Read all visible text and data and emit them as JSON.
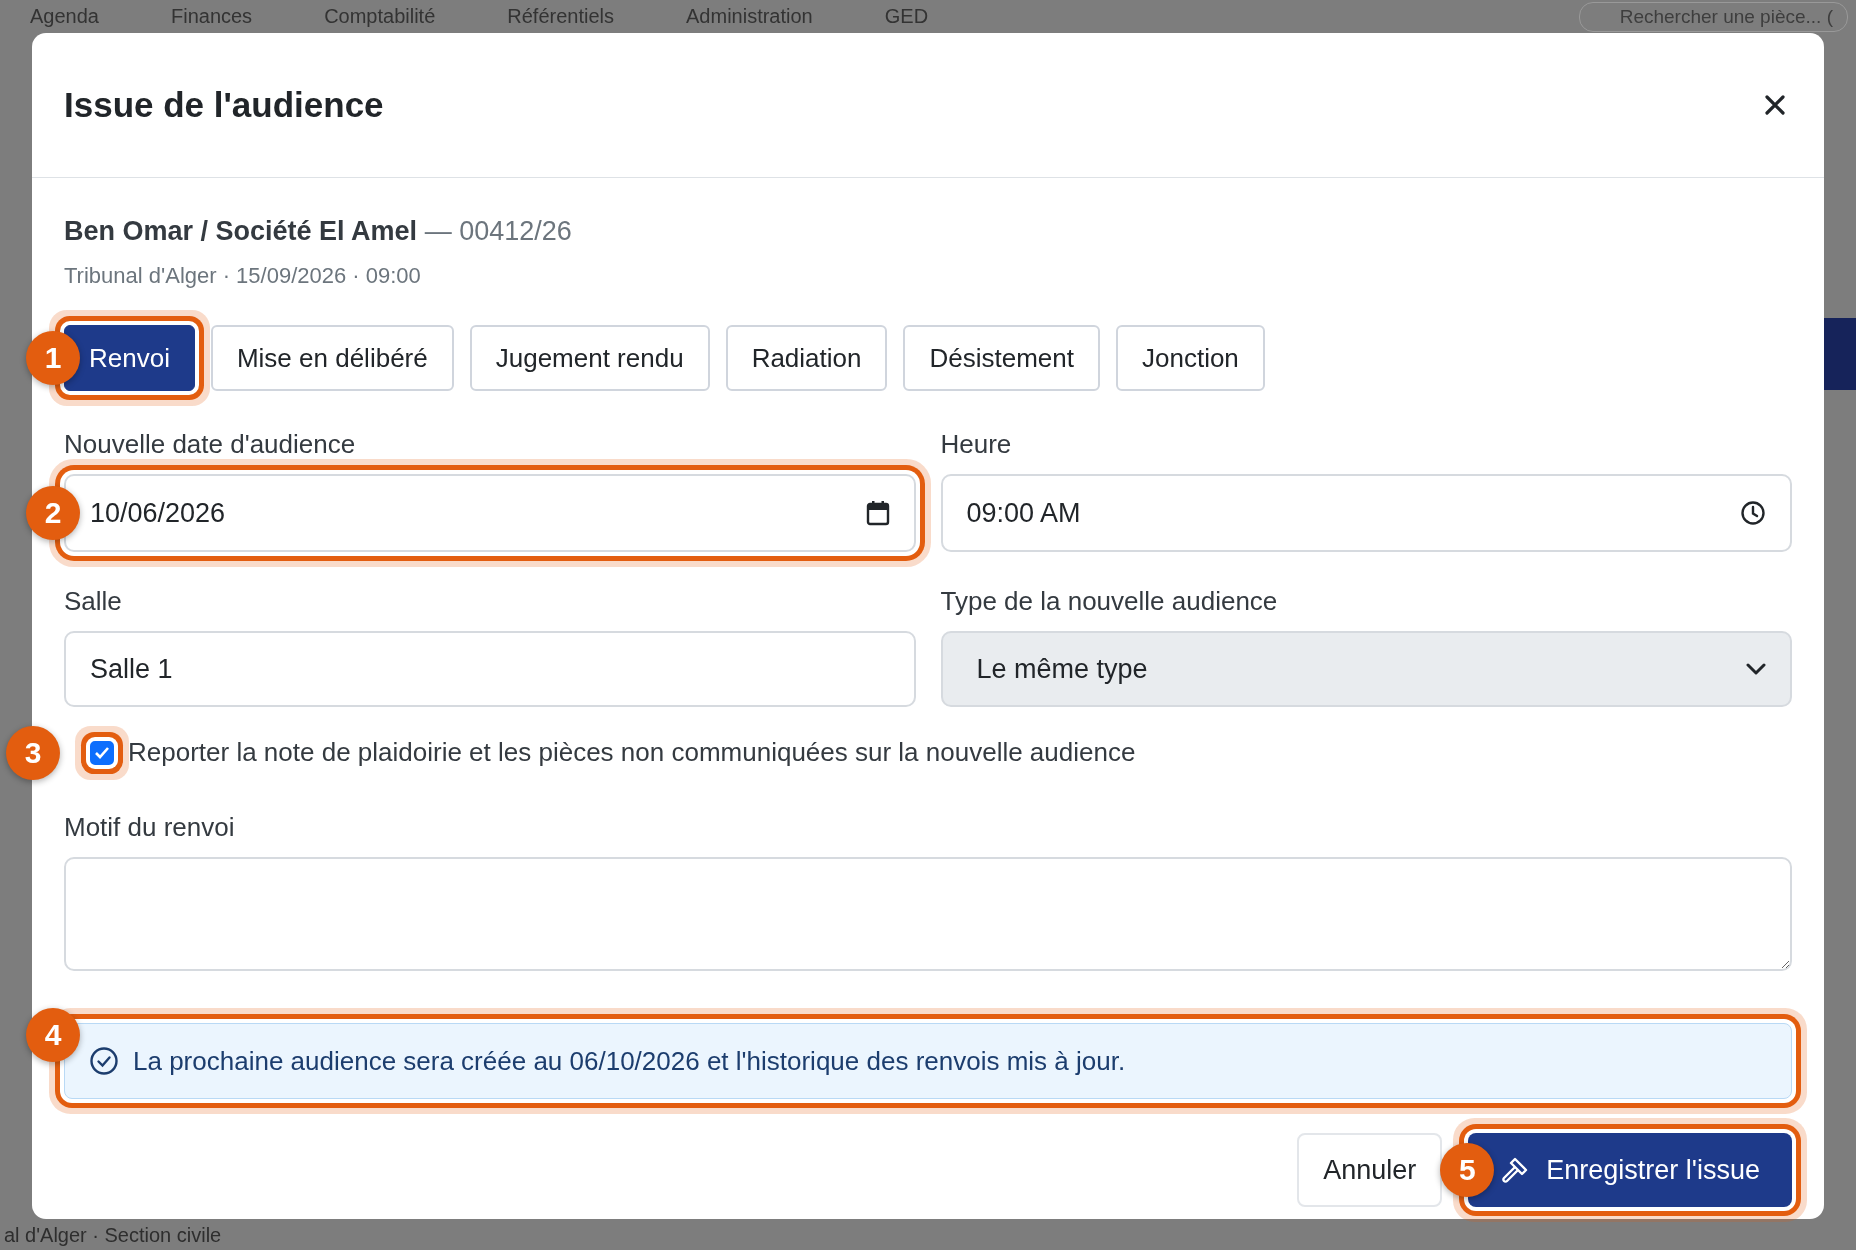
{
  "background": {
    "nav": [
      "Agenda",
      "Finances",
      "Comptabilité",
      "Référentiels",
      "Administration",
      "GED"
    ],
    "search_placeholder": "Rechercher une pièce... (",
    "footer_text": "al d'Alger · Section civile"
  },
  "dialog": {
    "title": "Issue de l'audience",
    "case": {
      "parties": "Ben Omar / Société El Amel",
      "number": "— 00412/26",
      "details": "Tribunal d'Alger · 15/09/2026 · 09:00"
    },
    "outcomes": [
      {
        "label": "Renvoi",
        "selected": true,
        "callout": "1"
      },
      {
        "label": "Mise en délibéré",
        "selected": false
      },
      {
        "label": "Jugement rendu",
        "selected": false
      },
      {
        "label": "Radiation",
        "selected": false
      },
      {
        "label": "Désistement",
        "selected": false
      },
      {
        "label": "Jonction",
        "selected": false
      }
    ],
    "fields": [
      {
        "kind": "date",
        "label": "Nouvelle date d'audience",
        "value": "10/06/2026",
        "callout": "2"
      },
      {
        "kind": "time",
        "label": "Heure",
        "value": "09:00 AM"
      },
      {
        "kind": "text",
        "label": "Salle",
        "value": "Salle 1"
      },
      {
        "kind": "select",
        "label": "Type de la nouvelle audience",
        "value": "Le même type"
      }
    ],
    "carry_over": {
      "label": "Reporter la note de plaidoirie et les pièces non communiquées sur la nouvelle audience",
      "checked": true,
      "callout": "3"
    },
    "motif": {
      "label": "Motif du renvoi"
    },
    "info": {
      "text": "La prochaine audience sera créée au 06/10/2026 et l'historique des renvois mis à jour.",
      "callout": "4"
    },
    "buttons": [
      {
        "kind": "secondary",
        "label": "Annuler"
      },
      {
        "kind": "primary",
        "label": "Enregistrer l'issue",
        "callout": "5"
      }
    ]
  }
}
